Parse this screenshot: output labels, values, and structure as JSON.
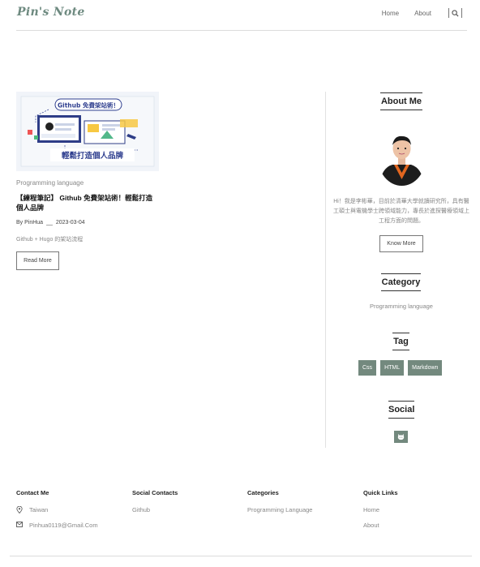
{
  "header": {
    "logo": "Pin's Note",
    "nav": {
      "home": "Home",
      "about": "About"
    }
  },
  "post": {
    "image_text": {
      "title": "Github 免費架站術！",
      "subtitle": "輕鬆打造個人品牌"
    },
    "category": "Programming language",
    "title": "【練程筆記】 Github 免費架站術！輕鬆打造個人品牌",
    "author": "By PinHua",
    "separator": "__",
    "date": "2023-03-04",
    "excerpt": "Github + Hugo 的架站流程",
    "read_more": "Read More"
  },
  "sidebar": {
    "about_heading": "About Me",
    "about_text": "Hi！我是李彬華，目前於清華大學就讀研究所，具有醫工碩士與電機學士跨領域能力，專長於進探醫療領域上工程方面的問題。",
    "know_more": "Know More",
    "category_heading": "Category",
    "categories": [
      "Programming language"
    ],
    "tag_heading": "Tag",
    "tags": [
      "Css",
      "HTML",
      "Markdown"
    ],
    "social_heading": "Social",
    "social_icon": "github-icon"
  },
  "footer": {
    "contact": {
      "heading": "Contact Me",
      "location": "Taiwan",
      "email": "Pinhua0119@Gmail.Com"
    },
    "social": {
      "heading": "Social Contacts",
      "links": [
        "Github"
      ]
    },
    "categories": {
      "heading": "Categories",
      "items": [
        "Programming Language"
      ]
    },
    "quick_links": {
      "heading": "Quick Links",
      "items": [
        "Home",
        "About"
      ]
    }
  },
  "colors": {
    "accent": "#73897e",
    "logo": "#6e8a80"
  }
}
